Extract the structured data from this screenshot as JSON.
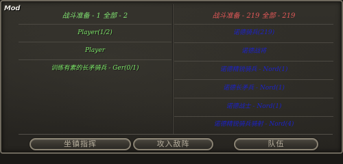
{
  "window": {
    "mode_label": "Mod"
  },
  "left_panel": {
    "header": "战斗准备 - 1   全部 - 2",
    "rows": [
      {
        "text": "Player(1/2)"
      },
      {
        "text": "Player"
      },
      {
        "text": "训练有素的长矛骑兵 - Ger(0/1)"
      }
    ]
  },
  "right_panel": {
    "header": "战斗准备 - 219   全部 - 219",
    "rows": [
      {
        "text": "诺德骑兵(219)"
      },
      {
        "text": "诺德战将"
      },
      {
        "text": "诺德精锐骑兵 - Nord(1)"
      },
      {
        "text": "诺德长矛兵 - Nord(1)"
      },
      {
        "text": "诺德战士 - Nord(1)"
      },
      {
        "text": "诺德精锐骑兵骑射 - Nord(4)"
      }
    ]
  },
  "buttons": {
    "formation_command": "坐镇指挥",
    "attack_enemy": "攻入敌阵",
    "troops": "队伍"
  },
  "colors": {
    "friendly_text": "#7ee86a",
    "enemy_header": "#e25858",
    "enemy_rows": "#1c22c8",
    "button_text": "#b9b19f"
  }
}
